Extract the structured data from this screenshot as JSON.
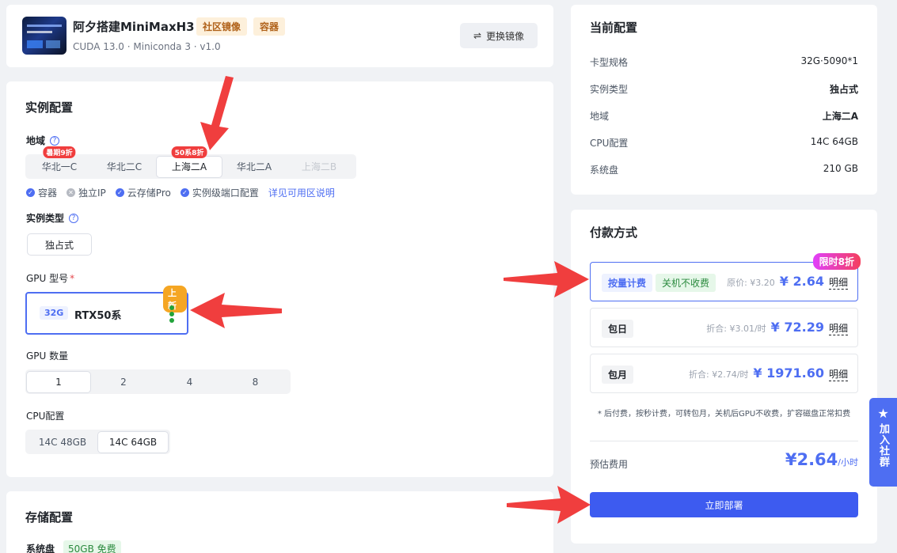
{
  "header": {
    "title": "阿夕搭建MiniMaxH3",
    "tags": [
      "社区镜像",
      "容器"
    ],
    "subtitle": "CUDA 13.0 · Miniconda 3 · v1.0",
    "swap_label": "更换镜像"
  },
  "instance": {
    "title": "实例配置",
    "region_label": "地域",
    "regions": [
      {
        "label": "华北一C",
        "badge": "暑期9折",
        "state": "normal"
      },
      {
        "label": "华北二C",
        "badge": "",
        "state": "normal"
      },
      {
        "label": "上海二A",
        "badge": "50系8折",
        "state": "selected"
      },
      {
        "label": "华北二A",
        "badge": "",
        "state": "normal"
      },
      {
        "label": "上海二B",
        "badge": "",
        "state": "disabled"
      }
    ],
    "features": [
      {
        "label": "容器",
        "ok": true
      },
      {
        "label": "独立IP",
        "ok": false
      },
      {
        "label": "云存储Pro",
        "ok": true
      },
      {
        "label": "实例级端口配置",
        "ok": true
      }
    ],
    "features_link": "详见可用区说明",
    "type_label": "实例类型",
    "type_value": "独占式",
    "gpu_model_label": "GPU 型号",
    "gpu_model_required": "*",
    "gpu": {
      "mem": "32G",
      "name": "RTX50系",
      "new_tag": "上新"
    },
    "gpu_count_label": "GPU 数量",
    "gpu_counts": [
      "1",
      "2",
      "4",
      "8"
    ],
    "cpu_label": "CPU配置",
    "cpu_options": [
      "14C 48GB",
      "14C 64GB"
    ]
  },
  "storage": {
    "title": "存储配置",
    "system_disk_label": "系统盘",
    "system_disk_free": "50GB 免费"
  },
  "current": {
    "title": "当前配置",
    "rows": [
      {
        "k": "卡型规格",
        "v": "32G·5090*1",
        "bold": false
      },
      {
        "k": "实例类型",
        "v": "独占式",
        "bold": true
      },
      {
        "k": "地域",
        "v": "上海二A",
        "bold": true
      },
      {
        "k": "CPU配置",
        "v": "14C 64GB",
        "bold": false
      },
      {
        "k": "系统盘",
        "v": "210 GB",
        "bold": false
      }
    ]
  },
  "payment": {
    "title": "付款方式",
    "plans": [
      {
        "tag": "按量计费",
        "tag2": "关机不收费",
        "orig": "原价: ¥3.20",
        "price": "¥ 2.64",
        "detail": "明细",
        "promo": "限时8折"
      },
      {
        "tag": "包日",
        "orig": "折合: ¥3.01/时",
        "price": "¥ 72.29",
        "detail": "明细"
      },
      {
        "tag": "包月",
        "orig": "折合: ¥2.74/时",
        "price": "¥ 1971.60",
        "detail": "明细"
      }
    ],
    "note": "* 后付费，按秒计费，可转包月，关机后GPU不收费，扩容磁盘正常扣费",
    "estimate_label": "预估费用",
    "estimate_price": "¥2.64",
    "estimate_unit": "/小时",
    "deploy_label": "立即部署"
  },
  "side": {
    "join_label": "加入社群"
  },
  "colors": {
    "accent": "#4e6ef2",
    "badge_red": "#f03e3e",
    "new_orange": "#f5a623",
    "free_green": "#2b8a3e"
  }
}
